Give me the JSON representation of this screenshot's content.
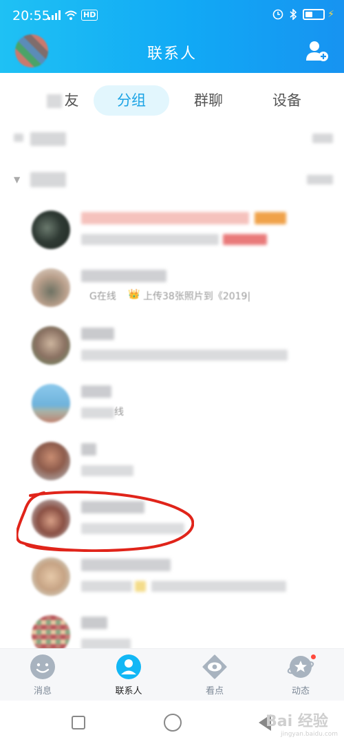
{
  "status_bar": {
    "time": "20:55",
    "network_label": "HD",
    "icons": [
      "signal-icon",
      "wifi-icon",
      "hd-icon",
      "alarm-icon",
      "bluetooth-icon",
      "battery-icon"
    ]
  },
  "header": {
    "title": "联系人",
    "add_icon": "add-friend-icon",
    "colors": {
      "gradient_start": "#1fc1f4",
      "gradient_end": "#1793f1"
    }
  },
  "tabs": [
    {
      "label": "友",
      "active": false
    },
    {
      "label": "分组",
      "active": true
    },
    {
      "label": "群聊",
      "active": false
    },
    {
      "label": "设备",
      "active": false
    }
  ],
  "contacts": [
    {
      "status_text": ""
    },
    {
      "status_text": "G在线"
    },
    {
      "status_text": "上传38张照片到《2019|"
    },
    {
      "status_text": "线"
    }
  ],
  "bottom_nav": [
    {
      "label": "消息",
      "icon": "message-icon",
      "active": false
    },
    {
      "label": "联系人",
      "icon": "contacts-icon",
      "active": true
    },
    {
      "label": "看点",
      "icon": "eye-icon",
      "active": false
    },
    {
      "label": "动态",
      "icon": "star-planet-icon",
      "active": false,
      "badge": true
    }
  ],
  "watermark": {
    "text": "Bai 经验",
    "sub": "jingyan.baidu.com"
  },
  "colors": {
    "accent": "#1aa3e5",
    "annotation_red": "#e0241a",
    "badge_red": "#ff4a3d"
  }
}
